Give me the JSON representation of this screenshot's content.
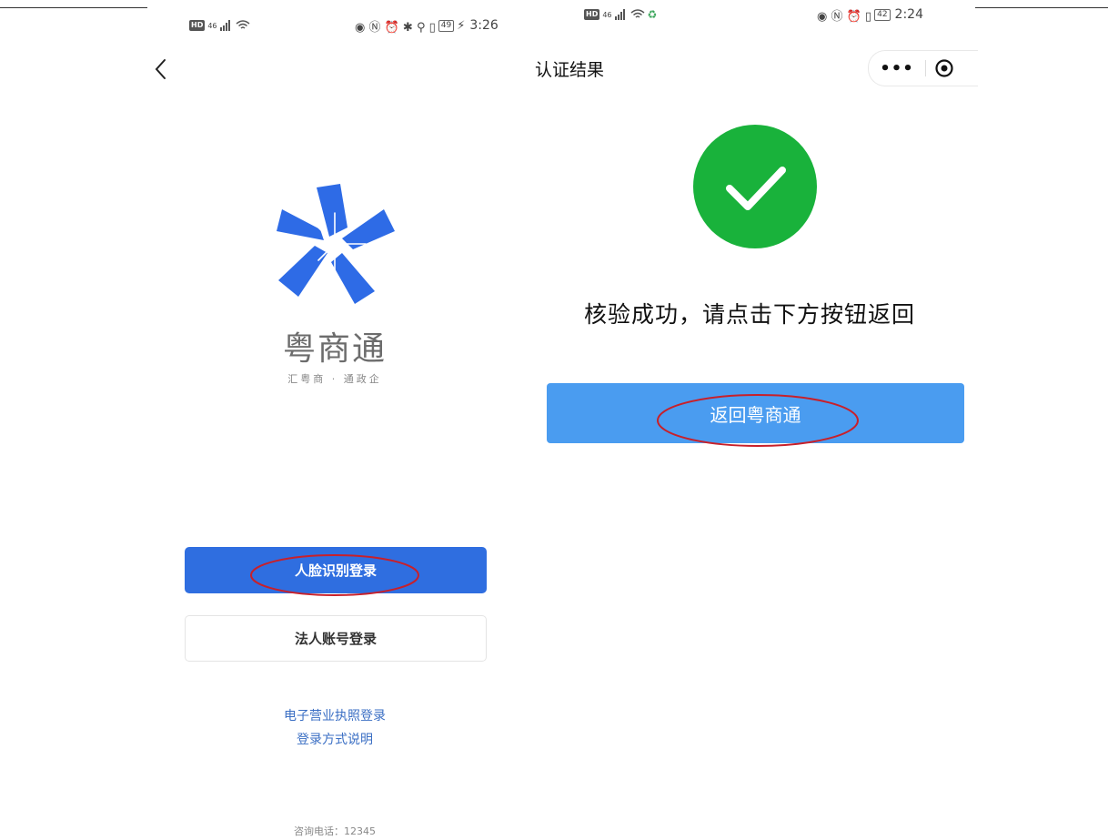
{
  "left_phone": {
    "status_bar": {
      "left_hd": "HD",
      "left_signal": "46",
      "right_icons": "◉ Ⓝ ⏰ ✱ ⚲ ▯",
      "battery": "49",
      "time": "3:26"
    },
    "brand": {
      "name": "粤商通",
      "slogan": "汇粤商 · 通政企",
      "logo_color": "#2e6be6"
    },
    "buttons": {
      "face_login": "人脸识别登录",
      "legal_login": "法人账号登录"
    },
    "links": {
      "license_login": "电子营业执照登录",
      "login_help": "登录方式说明"
    },
    "hotline": "咨询电话：12345"
  },
  "right_phone": {
    "status_bar": {
      "left_hd": "HD",
      "left_signal": "46",
      "right_icons": "◉ Ⓝ ⏰ ▯",
      "battery": "42",
      "time": "2:24"
    },
    "nav": {
      "title": "认证结果",
      "more": "•••"
    },
    "result": {
      "message": "核验成功，请点击下方按钮返回",
      "icon_color": "#19b23b"
    },
    "buttons": {
      "return": "返回粤商通"
    }
  },
  "colors": {
    "primary_blue": "#2f6ee0",
    "return_blue": "#4a9cf0",
    "link_blue": "#3b6fc4",
    "annotation_red": "#c8202a"
  }
}
